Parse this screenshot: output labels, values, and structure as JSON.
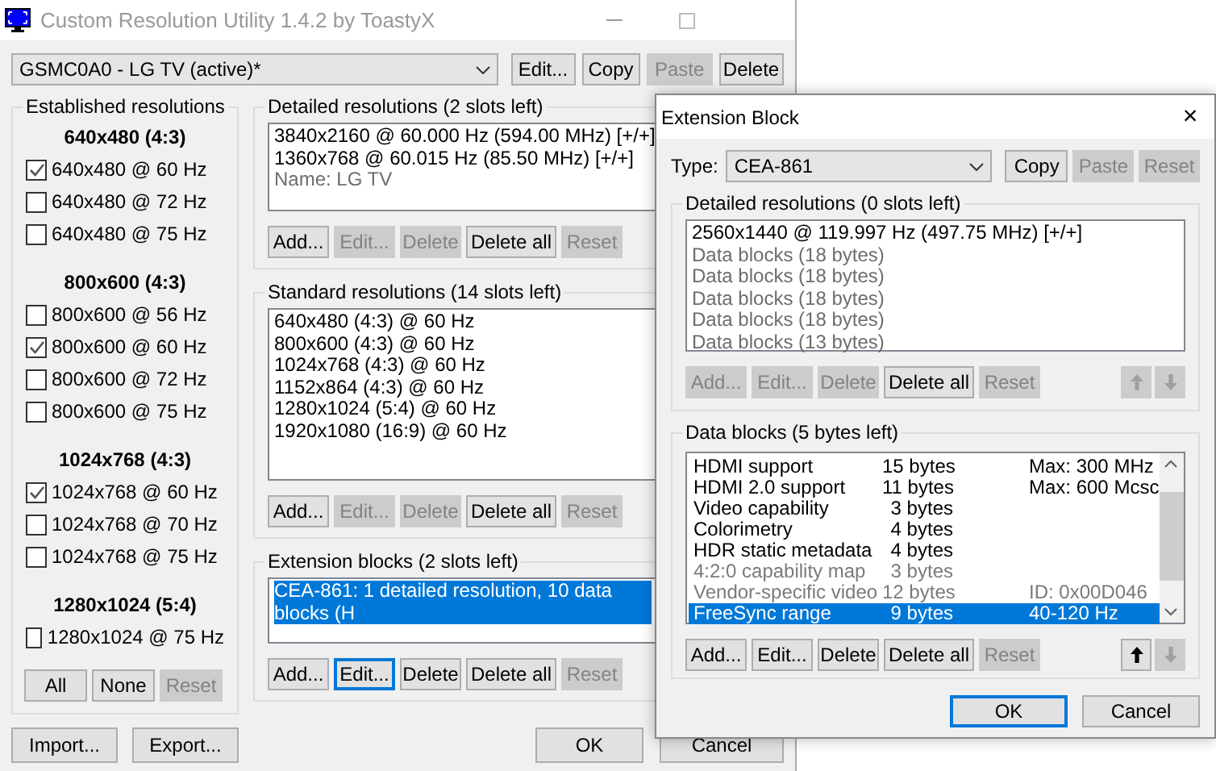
{
  "main_window": {
    "title": "Custom Resolution Utility 1.4.2 by ToastyX",
    "device_select": {
      "value": "GSMC0A0 - LG TV (active)*"
    },
    "top_buttons": [
      {
        "label": "Edit...",
        "disabled": false
      },
      {
        "label": "Copy",
        "disabled": false
      },
      {
        "label": "Paste",
        "disabled": true
      },
      {
        "label": "Delete",
        "disabled": false
      }
    ],
    "established": {
      "title": "Established resolutions",
      "groups": [
        {
          "heading": "640x480 (4:3)",
          "items": [
            {
              "label": "640x480 @ 60 Hz",
              "checked": true
            },
            {
              "label": "640x480 @ 72 Hz",
              "checked": false
            },
            {
              "label": "640x480 @ 75 Hz",
              "checked": false
            }
          ]
        },
        {
          "heading": "800x600 (4:3)",
          "items": [
            {
              "label": "800x600 @ 56 Hz",
              "checked": false
            },
            {
              "label": "800x600 @ 60 Hz",
              "checked": true
            },
            {
              "label": "800x600 @ 72 Hz",
              "checked": false
            },
            {
              "label": "800x600 @ 75 Hz",
              "checked": false
            }
          ]
        },
        {
          "heading": "1024x768 (4:3)",
          "items": [
            {
              "label": "1024x768 @ 60 Hz",
              "checked": true
            },
            {
              "label": "1024x768 @ 70 Hz",
              "checked": false
            },
            {
              "label": "1024x768 @ 75 Hz",
              "checked": false
            }
          ]
        },
        {
          "heading": "1280x1024 (5:4)",
          "items": [
            {
              "label": "1280x1024 @ 75 Hz",
              "checked": false
            }
          ]
        }
      ],
      "buttons": [
        {
          "label": "All",
          "disabled": false
        },
        {
          "label": "None",
          "disabled": false
        },
        {
          "label": "Reset",
          "disabled": true
        }
      ]
    },
    "detailed": {
      "title": "Detailed resolutions (2 slots left)",
      "lines": [
        {
          "text": "3840x2160 @ 60.000 Hz (594.00 MHz) [+/+]",
          "dim": false
        },
        {
          "text": "1360x768 @ 60.015 Hz (85.50 MHz) [+/+]",
          "dim": false
        },
        {
          "text": "Name: LG TV",
          "dim": true
        }
      ],
      "buttons": [
        {
          "label": "Add...",
          "disabled": false
        },
        {
          "label": "Edit...",
          "disabled": true
        },
        {
          "label": "Delete",
          "disabled": true
        },
        {
          "label": "Delete all",
          "disabled": false
        },
        {
          "label": "Reset",
          "disabled": true
        }
      ]
    },
    "standard": {
      "title": "Standard resolutions (14 slots left)",
      "lines": [
        {
          "text": "640x480 (4:3) @ 60 Hz"
        },
        {
          "text": "800x600 (4:3) @ 60 Hz"
        },
        {
          "text": "1024x768 (4:3) @ 60 Hz"
        },
        {
          "text": "1152x864 (4:3) @ 60 Hz"
        },
        {
          "text": "1280x1024 (5:4) @ 60 Hz"
        },
        {
          "text": "1920x1080 (16:9) @ 60 Hz"
        }
      ],
      "buttons": [
        {
          "label": "Add...",
          "disabled": false
        },
        {
          "label": "Edit...",
          "disabled": true
        },
        {
          "label": "Delete",
          "disabled": true
        },
        {
          "label": "Delete all",
          "disabled": false
        },
        {
          "label": "Reset",
          "disabled": true
        }
      ]
    },
    "extension": {
      "title": "Extension blocks (2 slots left)",
      "lines": [
        {
          "text": "CEA-861: 1 detailed resolution, 10 data blocks (H",
          "selected": true
        }
      ],
      "buttons": [
        {
          "label": "Add...",
          "disabled": false,
          "focused": false
        },
        {
          "label": "Edit...",
          "disabled": false,
          "focused": true
        },
        {
          "label": "Delete",
          "disabled": false,
          "focused": false
        },
        {
          "label": "Delete all",
          "disabled": false,
          "focused": false
        },
        {
          "label": "Reset",
          "disabled": true,
          "focused": false
        }
      ]
    },
    "bottom_buttons": [
      {
        "label": "Import..."
      },
      {
        "label": "Export..."
      }
    ],
    "ok": {
      "label": "OK"
    },
    "cancel": {
      "label": "Cancel"
    }
  },
  "dialog": {
    "title": "Extension Block",
    "close": "×",
    "type_label": "Type:",
    "type_select": {
      "value": "CEA-861"
    },
    "buttons": [
      {
        "label": "Copy",
        "disabled": false
      },
      {
        "label": "Paste",
        "disabled": true
      },
      {
        "label": "Reset",
        "disabled": true
      }
    ],
    "detailed": {
      "title": "Detailed resolutions (0 slots left)",
      "lines": [
        {
          "text": "2560x1440 @ 119.997 Hz (497.75 MHz) [+/+]",
          "dim": false
        },
        {
          "text": "Data blocks (18 bytes)",
          "dim": true
        },
        {
          "text": "Data blocks (18 bytes)",
          "dim": true
        },
        {
          "text": "Data blocks (18 bytes)",
          "dim": true
        },
        {
          "text": "Data blocks (18 bytes)",
          "dim": true
        },
        {
          "text": "Data blocks (13 bytes)",
          "dim": true
        }
      ],
      "buttons": [
        {
          "label": "Add...",
          "disabled": true
        },
        {
          "label": "Edit...",
          "disabled": true
        },
        {
          "label": "Delete",
          "disabled": true
        },
        {
          "label": "Delete all",
          "disabled": false
        },
        {
          "label": "Reset",
          "disabled": true
        }
      ],
      "arrows": [
        {
          "disabled": true
        },
        {
          "disabled": true
        }
      ]
    },
    "data_blocks": {
      "title": "Data blocks (5 bytes left)",
      "rows": [
        {
          "name": "HDMI support",
          "size": "15 bytes",
          "info": "Max: 300 MHz",
          "dim": false,
          "selected": false
        },
        {
          "name": "HDMI 2.0 support",
          "size": "11 bytes",
          "info": "Max: 600 Mcsc",
          "dim": false,
          "selected": false
        },
        {
          "name": "Video capability",
          "size": "3 bytes",
          "dim": false,
          "selected": false
        },
        {
          "name": "Colorimetry",
          "size": "4 bytes",
          "dim": false,
          "selected": false
        },
        {
          "name": "HDR static metadata",
          "size": "4 bytes",
          "dim": false,
          "selected": false
        },
        {
          "name": "4:2:0 capability map",
          "size": "3 bytes",
          "dim": true,
          "selected": false
        },
        {
          "name": "Vendor-specific video",
          "size": "12 bytes",
          "info": "ID: 0x00D046",
          "dim": true,
          "selected": false
        },
        {
          "name": "FreeSync range",
          "size": "9 bytes",
          "info": "40-120 Hz",
          "dim": false,
          "selected": true
        }
      ],
      "buttons": [
        {
          "label": "Add...",
          "disabled": false
        },
        {
          "label": "Edit...",
          "disabled": false
        },
        {
          "label": "Delete",
          "disabled": false
        },
        {
          "label": "Delete all",
          "disabled": false
        },
        {
          "label": "Reset",
          "disabled": true
        }
      ],
      "arrows": [
        {
          "disabled": false
        },
        {
          "disabled": true
        }
      ]
    },
    "ok": {
      "label": "OK",
      "focused": true
    },
    "cancel": {
      "label": "Cancel",
      "focused": false
    }
  }
}
